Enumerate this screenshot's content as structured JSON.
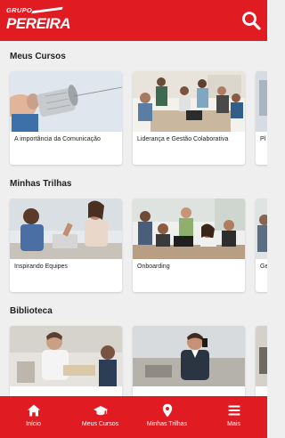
{
  "header": {
    "logo_top": "GRUPO",
    "logo_main": "PEREIRA",
    "search_icon": "search-icon"
  },
  "sections": [
    {
      "title": "Meus Cursos",
      "cards": [
        {
          "label": "A importância da Comunicação"
        },
        {
          "label": "Liderança e Gestão Colaborativa"
        },
        {
          "label": "Pl"
        }
      ]
    },
    {
      "title": "Minhas Trilhas",
      "cards": [
        {
          "label": "Inspirando Equipes"
        },
        {
          "label": "Onboarding"
        },
        {
          "label": "Ge"
        }
      ]
    },
    {
      "title": "Biblioteca",
      "cards": [
        {
          "label": ""
        },
        {
          "label": ""
        },
        {
          "label": ""
        }
      ]
    }
  ],
  "bottom_nav": [
    {
      "label": "Início",
      "icon": "home-icon"
    },
    {
      "label": "Meus Cursos",
      "icon": "graduation-cap-icon"
    },
    {
      "label": "Minhas Trilhas",
      "icon": "map-pin-icon"
    },
    {
      "label": "Mais",
      "icon": "menu-icon"
    }
  ],
  "colors": {
    "brand_red": "#e11b22",
    "background": "#efefef"
  }
}
